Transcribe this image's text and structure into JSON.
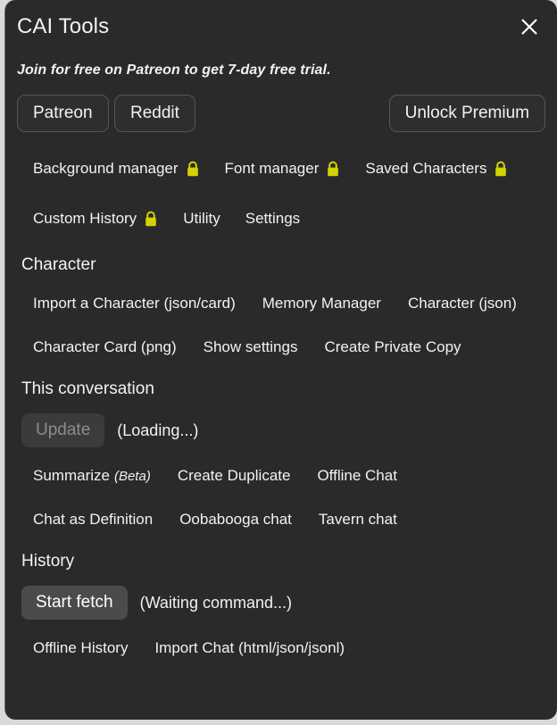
{
  "window": {
    "title": "CAI Tools",
    "close_icon": "close-icon",
    "tagline": "Join for free on Patreon to get 7-day free trial."
  },
  "top_buttons": [
    {
      "label": "Patreon",
      "name": "patreon-button"
    },
    {
      "label": "Reddit",
      "name": "reddit-button"
    },
    {
      "label": "Unlock Premium",
      "name": "unlock-premium-button"
    }
  ],
  "nav": {
    "row1": [
      {
        "label": "Background manager",
        "locked": true,
        "lock_icon": "lock-icon"
      },
      {
        "label": "Font manager",
        "locked": true,
        "lock_icon": "lock-icon"
      },
      {
        "label": "Saved Characters",
        "locked": true,
        "lock_icon": "lock-icon"
      }
    ],
    "row2": [
      {
        "label": "Custom History",
        "locked": true,
        "lock_icon": "lock-icon"
      },
      {
        "label": "Utility",
        "locked": false
      },
      {
        "label": "Settings",
        "locked": false
      }
    ]
  },
  "sections": {
    "character": {
      "title": "Character",
      "row1": [
        "Import a Character (json/card)",
        "Memory Manager",
        "Character (json)"
      ],
      "row2": [
        "Character Card (png)",
        "Show settings",
        "Create Private Copy"
      ]
    },
    "conversation": {
      "title": "This conversation",
      "action": {
        "button_label": "Update",
        "status": "(Loading...)",
        "state": "disabled"
      },
      "row1": [
        {
          "label": "Summarize",
          "suffix": "(Beta)"
        },
        {
          "label": "Create Duplicate",
          "suffix": ""
        },
        {
          "label": "Offline Chat",
          "suffix": ""
        }
      ],
      "row2": [
        "Chat as Definition",
        "Oobabooga chat",
        "Tavern chat"
      ]
    },
    "history": {
      "title": "History",
      "action": {
        "button_label": "Start fetch",
        "status": "(Waiting command...)",
        "state": "active"
      },
      "row1": [
        "Offline History",
        "Import Chat (html/json/jsonl)"
      ]
    }
  },
  "colors": {
    "panel_bg": "#2a2a2a",
    "text": "#f2f2f2",
    "lock_yellow": "#d4d400",
    "button_border": "#565656",
    "disabled_button_bg": "#3b3b3b",
    "disabled_button_text": "#8d8d8d",
    "active_button_bg": "#4b4b4b"
  }
}
